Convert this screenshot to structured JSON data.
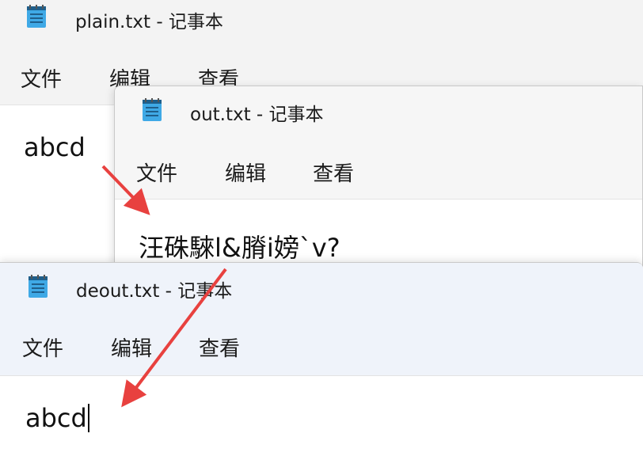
{
  "windows": {
    "plain": {
      "title": "plain.txt - 记事本",
      "menu": [
        "文件",
        "编辑",
        "查看"
      ],
      "content": "abcd"
    },
    "out": {
      "title": "out.txt - 记事本",
      "menu": [
        "文件",
        "编辑",
        "查看"
      ],
      "content": "汪硃騋l&膌i嫎`v?"
    },
    "deout": {
      "title": "deout.txt - 记事本",
      "menu": [
        "文件",
        "编辑",
        "查看"
      ],
      "content": "abcd"
    }
  },
  "icons": {
    "app": "notepad-icon",
    "annotation": "arrow-icon"
  },
  "colors": {
    "arrow": "#e8413f",
    "icon_body": "#3fa9e6",
    "icon_lines": "#1f5f8b"
  }
}
